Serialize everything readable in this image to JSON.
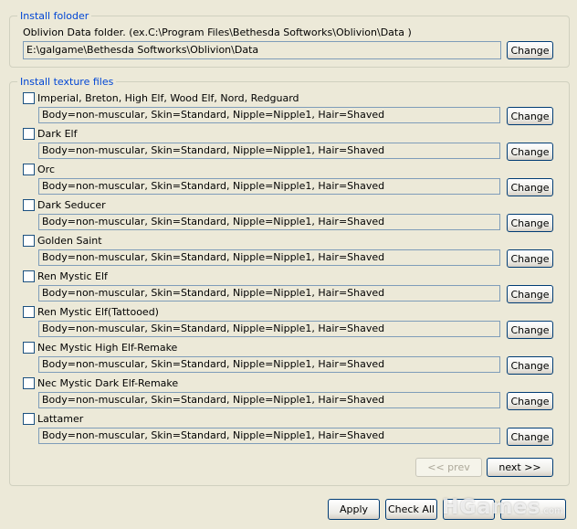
{
  "install_folder": {
    "legend": "Install foloder",
    "description": "Oblivion Data folder. (ex.C:\\Program Files\\Bethesda Softworks\\Oblivion\\Data )",
    "path": "E:\\galgame\\Bethesda Softworks\\Oblivion\\Data",
    "change_label": "Change"
  },
  "texture_files": {
    "legend": "Install texture files",
    "change_label": "Change",
    "items": [
      {
        "race": "Imperial, Breton, High Elf, Wood Elf, Nord, Redguard",
        "setting": "Body=non-muscular, Skin=Standard, Nipple=Nipple1, Hair=Shaved",
        "checked": false
      },
      {
        "race": "Dark Elf",
        "setting": "Body=non-muscular, Skin=Standard, Nipple=Nipple1, Hair=Shaved",
        "checked": false
      },
      {
        "race": "Orc",
        "setting": "Body=non-muscular, Skin=Standard, Nipple=Nipple1, Hair=Shaved",
        "checked": false
      },
      {
        "race": "Dark Seducer",
        "setting": "Body=non-muscular, Skin=Standard, Nipple=Nipple1, Hair=Shaved",
        "checked": false
      },
      {
        "race": "Golden Saint",
        "setting": "Body=non-muscular, Skin=Standard, Nipple=Nipple1, Hair=Shaved",
        "checked": false
      },
      {
        "race": "Ren Mystic Elf",
        "setting": "Body=non-muscular, Skin=Standard, Nipple=Nipple1, Hair=Shaved",
        "checked": false
      },
      {
        "race": "Ren Mystic Elf(Tattooed)",
        "setting": "Body=non-muscular, Skin=Standard, Nipple=Nipple1, Hair=Shaved",
        "checked": false
      },
      {
        "race": "Nec Mystic High Elf-Remake",
        "setting": "Body=non-muscular, Skin=Standard, Nipple=Nipple1, Hair=Shaved",
        "checked": false
      },
      {
        "race": "Nec Mystic Dark Elf-Remake",
        "setting": "Body=non-muscular, Skin=Standard, Nipple=Nipple1, Hair=Shaved",
        "checked": false
      },
      {
        "race": "Lattamer",
        "setting": "Body=non-muscular, Skin=Standard, Nipple=Nipple1, Hair=Shaved",
        "checked": false
      }
    ],
    "prev_label": "<< prev",
    "next_label": "next >>"
  },
  "footer": {
    "apply_label": "Apply",
    "check_all_label": "Check All",
    "watermark_text": "HGames",
    "watermark_small": ".com"
  },
  "colors": {
    "window_bg": "#ece9d8",
    "legend_text": "#0046d5",
    "button_border": "#003c74",
    "field_border": "#7f9db9"
  }
}
